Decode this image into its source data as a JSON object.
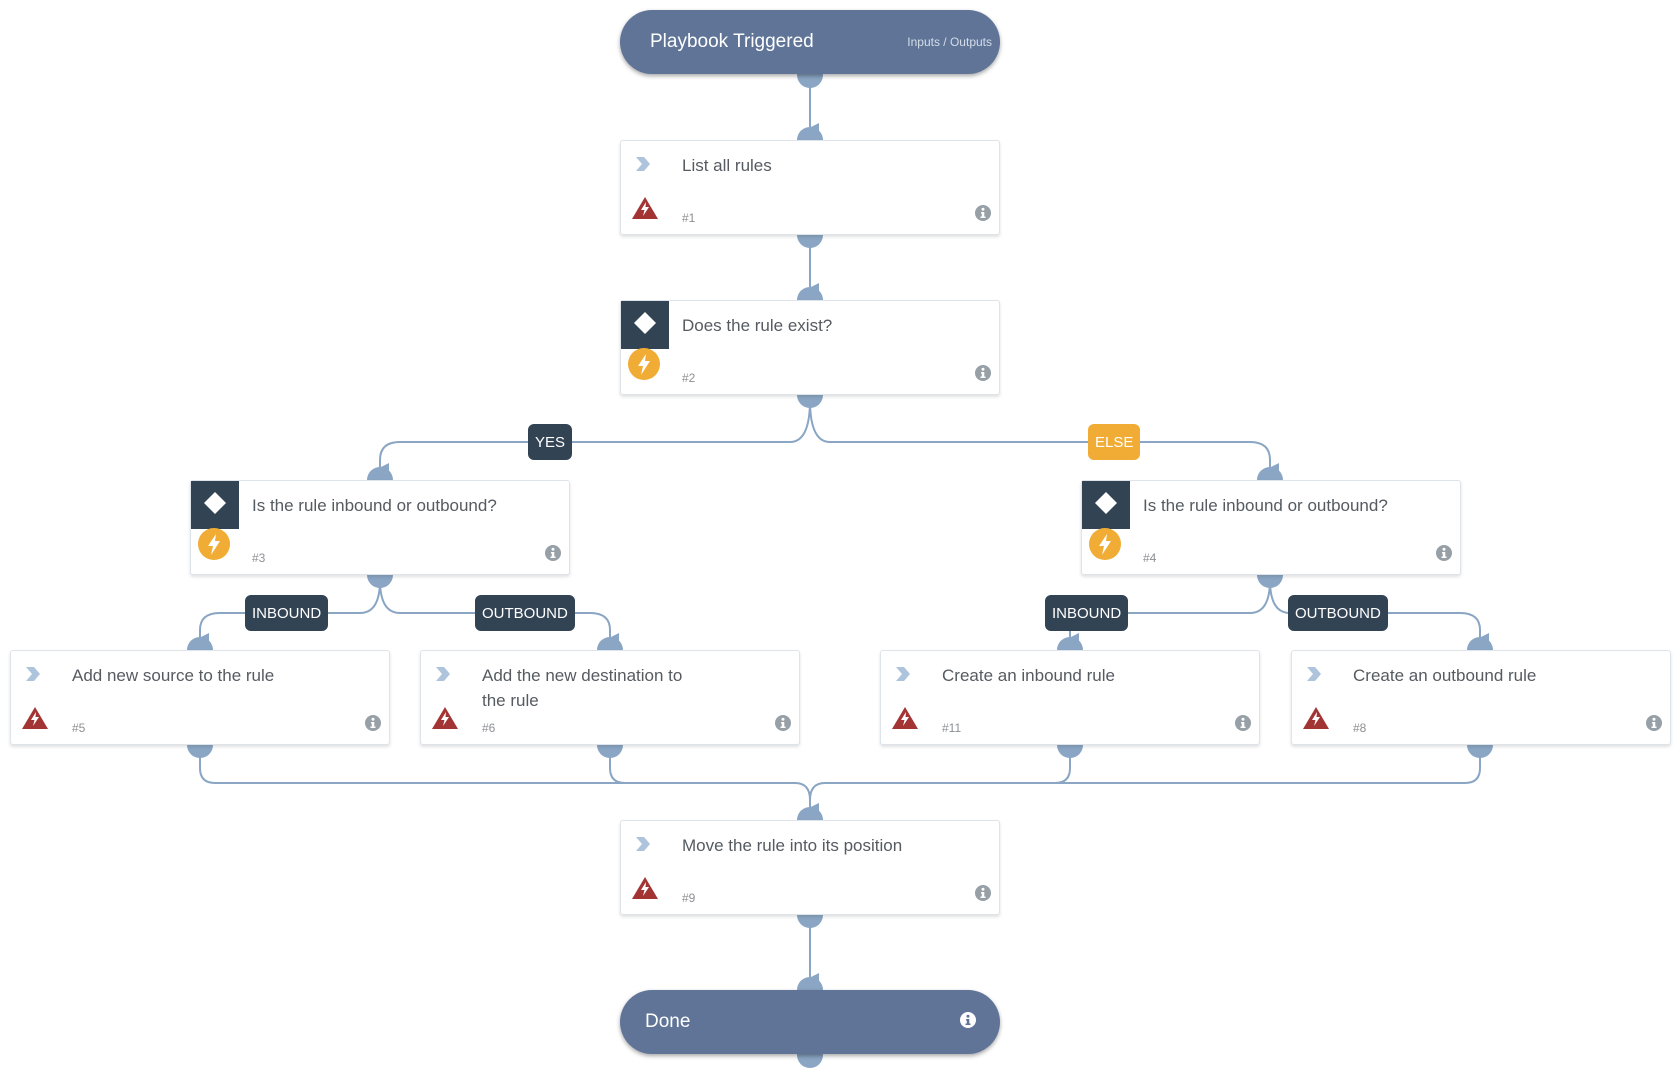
{
  "diagram": {
    "colors": {
      "connector": "#8aa6c4",
      "pill": "#5f7497",
      "condition_header": "#324354",
      "else_badge": "#f0ac34",
      "manual_bolt": "#f0ac34",
      "error_warning": "#a33434",
      "chevron": "#adc4dc",
      "info_icon": "#97a0a6"
    },
    "start": {
      "title": "Playbook Triggered",
      "io_label": "Inputs / Outputs"
    },
    "end": {
      "title": "Done"
    },
    "tasks": [
      {
        "id": "1",
        "name": "List all rules",
        "number": "#1",
        "kind": "action"
      },
      {
        "id": "2",
        "name": "Does the rule exist?",
        "number": "#2",
        "kind": "condition"
      },
      {
        "id": "3",
        "name": "Is the rule inbound or outbound?",
        "number": "#3",
        "kind": "condition"
      },
      {
        "id": "4",
        "name": "Is the rule inbound or outbound?",
        "number": "#4",
        "kind": "condition"
      },
      {
        "id": "5",
        "name": "Add new source to the rule",
        "number": "#5",
        "kind": "action"
      },
      {
        "id": "6",
        "name": "Add the new destination to the rule",
        "number": "#6",
        "kind": "action"
      },
      {
        "id": "11",
        "name": "Create an inbound rule",
        "number": "#11",
        "kind": "action"
      },
      {
        "id": "8",
        "name": "Create an outbound rule",
        "number": "#8",
        "kind": "action"
      },
      {
        "id": "9",
        "name": "Move the rule into its position",
        "number": "#9",
        "kind": "action"
      }
    ],
    "branch_labels": {
      "yes": "YES",
      "else": "ELSE",
      "left_inbound": "INBOUND",
      "left_outbound": "OUTBOUND",
      "right_inbound": "INBOUND",
      "right_outbound": "OUTBOUND"
    },
    "edges": [
      {
        "from": "start",
        "to": "1"
      },
      {
        "from": "1",
        "to": "2"
      },
      {
        "from": "2",
        "to": "3",
        "label": "YES"
      },
      {
        "from": "2",
        "to": "4",
        "label": "ELSE"
      },
      {
        "from": "3",
        "to": "5",
        "label": "INBOUND"
      },
      {
        "from": "3",
        "to": "6",
        "label": "OUTBOUND"
      },
      {
        "from": "4",
        "to": "11",
        "label": "INBOUND"
      },
      {
        "from": "4",
        "to": "8",
        "label": "OUTBOUND"
      },
      {
        "from": "5",
        "to": "9"
      },
      {
        "from": "6",
        "to": "9"
      },
      {
        "from": "11",
        "to": "9"
      },
      {
        "from": "8",
        "to": "9"
      },
      {
        "from": "9",
        "to": "end"
      }
    ]
  }
}
